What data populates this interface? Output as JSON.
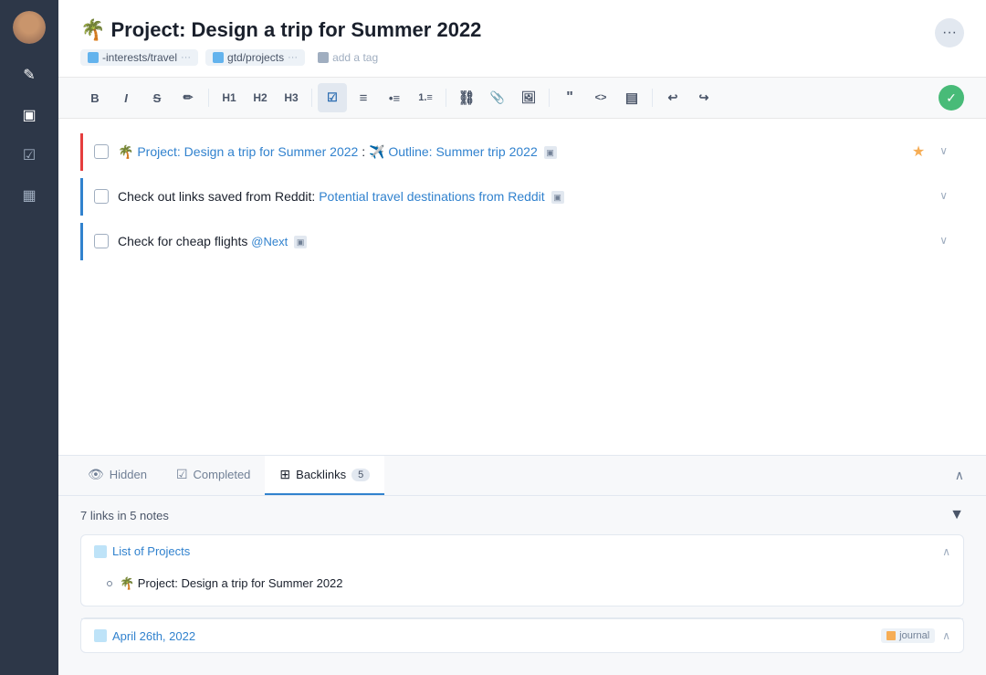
{
  "sidebar": {
    "icons": [
      {
        "name": "edit-icon",
        "symbol": "✎",
        "active": false
      },
      {
        "name": "document-icon",
        "symbol": "▣",
        "active": true
      },
      {
        "name": "checkbox-icon",
        "symbol": "☑",
        "active": false
      },
      {
        "name": "calendar-icon",
        "symbol": "▦",
        "active": false
      }
    ]
  },
  "header": {
    "title": "🌴 Project: Design a trip for Summer 2022",
    "tags": [
      {
        "label": "-interests/travel",
        "type": "blue"
      },
      {
        "label": "gtd/projects",
        "type": "blue"
      },
      {
        "label": "add a tag",
        "type": "add"
      }
    ]
  },
  "toolbar": {
    "buttons": [
      {
        "label": "B",
        "name": "bold-button",
        "style": "bold"
      },
      {
        "label": "I",
        "name": "italic-button",
        "style": "italic"
      },
      {
        "label": "S̶",
        "name": "strikethrough-button"
      },
      {
        "label": "✏",
        "name": "pen-button"
      },
      {
        "label": "H1",
        "name": "h1-button"
      },
      {
        "label": "H2",
        "name": "h2-button"
      },
      {
        "label": "H3",
        "name": "h3-button"
      },
      {
        "label": "☑",
        "name": "checklist-button",
        "active": true
      },
      {
        "label": "≡",
        "name": "list-indent-button"
      },
      {
        "label": "•",
        "name": "bullet-list-button"
      },
      {
        "label": "1.",
        "name": "ordered-list-button"
      },
      {
        "label": "⛓",
        "name": "link-button"
      },
      {
        "label": "📎",
        "name": "attach-button"
      },
      {
        "label": "🖼",
        "name": "image-button"
      },
      {
        "label": "❝",
        "name": "quote-button"
      },
      {
        "label": "<>",
        "name": "code-button"
      },
      {
        "label": "▤",
        "name": "table-button"
      },
      {
        "label": "↩",
        "name": "undo-button"
      },
      {
        "label": "↪",
        "name": "redo-button"
      }
    ],
    "sync_label": "✓"
  },
  "content": {
    "todo_items": [
      {
        "id": "todo-1",
        "border": "red",
        "text_before": "🌴 Project: Design a trip for Summer 2022",
        "separator": " : ",
        "link_text": "✈️ Outline: Summer trip 2022",
        "has_doc_icon": true,
        "has_star": true,
        "expanded": true
      },
      {
        "id": "todo-2",
        "border": "blue",
        "text_before": "Check out links saved from Reddit:",
        "link_text": "Potential travel destinations from Reddit",
        "has_doc_icon": true,
        "expanded": false
      },
      {
        "id": "todo-3",
        "border": "blue",
        "text_before": "Check for cheap flights",
        "tag_text": "@Next",
        "has_doc_icon": true,
        "expanded": false
      }
    ]
  },
  "bottom_panel": {
    "tabs": [
      {
        "name": "hidden-tab",
        "icon": "👁",
        "label": "Hidden",
        "active": false
      },
      {
        "name": "completed-tab",
        "icon": "☑",
        "label": "Completed",
        "active": false
      },
      {
        "name": "backlinks-tab",
        "icon": "⊞",
        "label": "Backlinks",
        "count": "5",
        "active": true
      }
    ],
    "backlinks": {
      "summary": "7 links in 5 notes",
      "groups": [
        {
          "title": "List of Projects",
          "items": [
            {
              "text": "🌴 Project: Design a trip for Summer 2022"
            }
          ],
          "expanded": true
        }
      ],
      "date_groups": [
        {
          "date": "April 26th, 2022",
          "badge": "journal",
          "expanded": true
        }
      ]
    }
  }
}
